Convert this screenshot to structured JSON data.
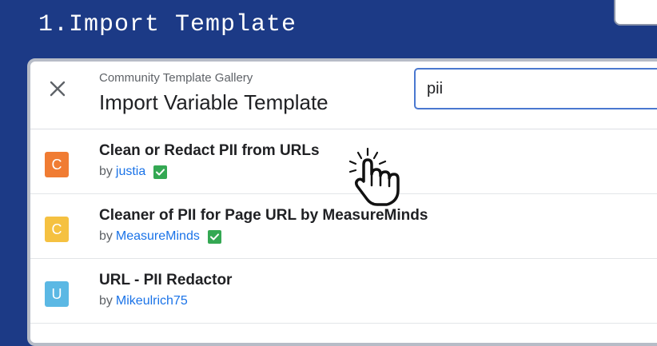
{
  "slide": {
    "title": "1.Import Template"
  },
  "dialog": {
    "subtitle": "Community Template Gallery",
    "title": "Import Variable Template",
    "search": {
      "value": "pii"
    }
  },
  "results": [
    {
      "badge": "C",
      "badge_color": "#f07c33",
      "title": "Clean or Redact PII from URLs",
      "by": "by",
      "author": "justia",
      "verified": true
    },
    {
      "badge": "C",
      "badge_color": "#f5c141",
      "title": "Cleaner of PII for Page URL by MeasureMinds",
      "by": "by",
      "author": "MeasureMinds",
      "verified": true
    },
    {
      "badge": "U",
      "badge_color": "#5bb8e4",
      "title": "URL - PII Redactor",
      "by": "by",
      "author": "Mikeulrich75",
      "verified": false
    }
  ],
  "colors": {
    "background": "#1c3a86",
    "link": "#1a73e8",
    "verified": "#34a853"
  },
  "icons": {
    "close": "close-icon",
    "verified": "verified-check-icon",
    "cursor": "hand-pointer-icon"
  }
}
